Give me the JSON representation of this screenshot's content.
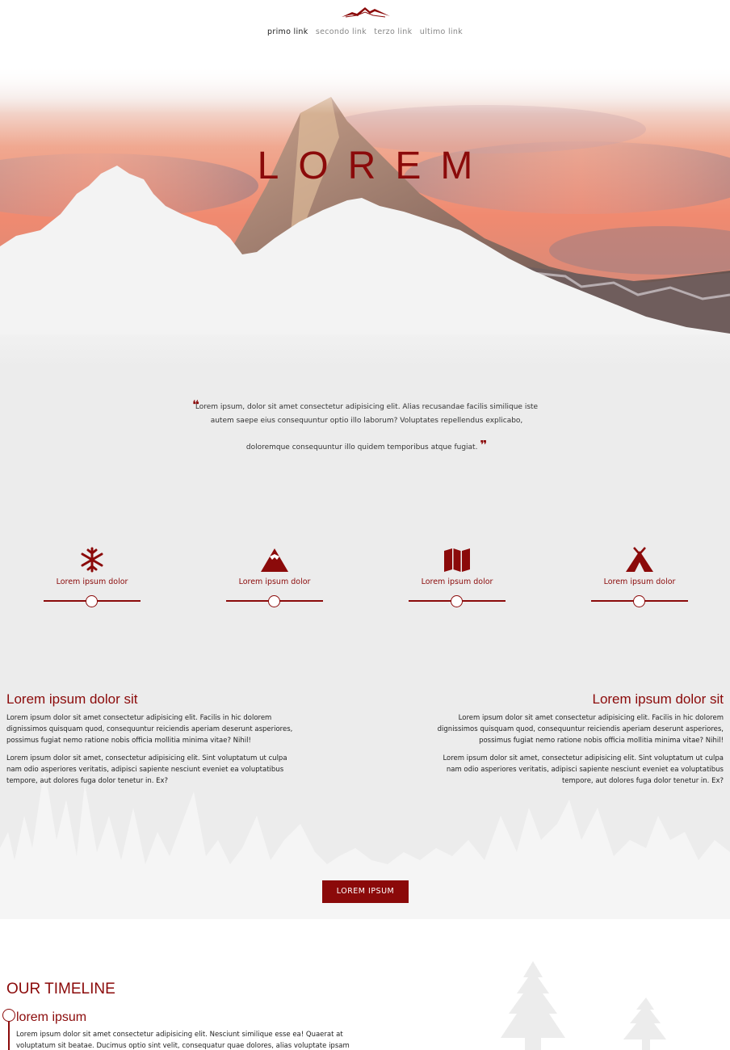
{
  "nav": {
    "items": [
      "primo link",
      "secondo link",
      "terzo link",
      "ultimo link"
    ],
    "active_index": 0
  },
  "hero": {
    "title": "LOREM"
  },
  "quote": {
    "line1": "Lorem ipsum, dolor sit amet consectetur adipisicing elit. Alias recusandae facilis similique iste autem saepe eius consequuntur optio illo laborum? Voluptates repellendus explicabo,",
    "line2": "doloremque consequuntur illo quidem temporibus atque fugiat."
  },
  "features": [
    {
      "icon": "snowflake-icon",
      "label": "Lorem ipsum dolor"
    },
    {
      "icon": "mountain-icon",
      "label": "Lorem ipsum dolor"
    },
    {
      "icon": "map-icon",
      "label": "Lorem ipsum dolor"
    },
    {
      "icon": "tent-icon",
      "label": "Lorem ipsum dolor"
    }
  ],
  "columns": {
    "left": {
      "title": "Lorem ipsum dolor sit",
      "p1": "Lorem ipsum dolor sit amet consectetur adipisicing elit. Facilis in hic dolorem dignissimos quisquam quod, consequuntur reiciendis aperiam deserunt asperiores, possimus fugiat nemo ratione nobis officia mollitia minima vitae? Nihil!",
      "p2": "Lorem ipsum dolor sit amet, consectetur adipisicing elit. Sint voluptatum ut culpa nam odio asperiores veritatis, adipisci sapiente nesciunt eveniet ea voluptatibus tempore, aut dolores fuga dolor tenetur in. Ex?"
    },
    "right": {
      "title": "Lorem ipsum dolor sit",
      "p1": "Lorem ipsum dolor sit amet consectetur adipisicing elit. Facilis in hic dolorem dignissimos quisquam quod, consequuntur reiciendis aperiam deserunt asperiores, possimus fugiat nemo ratione nobis officia mollitia minima vitae? Nihil!",
      "p2": "Lorem ipsum dolor sit amet, consectetur adipisicing elit. Sint voluptatum ut culpa nam odio asperiores veritatis, adipisci sapiente nesciunt eveniet ea voluptatibus tempore, aut dolores fuga dolor tenetur in. Ex?"
    }
  },
  "cta": {
    "label": "LOREM IPSUM"
  },
  "timeline": {
    "title": "OUR TIMELINE",
    "entry_title": "lorem ipsum",
    "entry_text": "Lorem ipsum dolor sit amet consectetur adipisicing elit. Nesciunt similique esse ea! Quaerat at voluptatum sit beatae. Ducimus optio sint velit, consequatur quae dolores, alias voluptate ipsam"
  },
  "colors": {
    "accent": "#8b0a0a",
    "background": "#ececec"
  }
}
